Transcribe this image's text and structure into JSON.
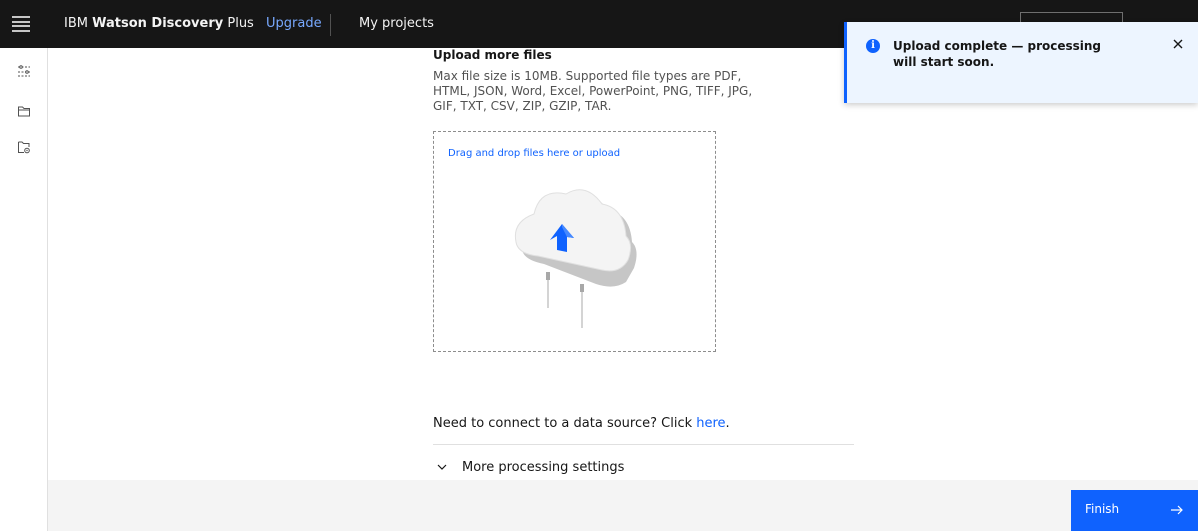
{
  "header": {
    "menu_icon": "hamburger-menu-icon",
    "brand_prefix": "IBM ",
    "brand_bold": "Watson Discovery",
    "brand_suffix": " Plus",
    "upgrade_label": "Upgrade",
    "my_projects_label": "My projects"
  },
  "side_rail": {
    "icons": [
      "settings-sliders-icon",
      "folder-icon",
      "folder-settings-icon"
    ]
  },
  "upload": {
    "title": "Upload more files",
    "description": "Max file size is 10MB. Supported file types are PDF, HTML, JSON, Word, Excel, PowerPoint, PNG, TIFF, JPG, GIF, TXT, CSV, ZIP, GZIP, TAR.",
    "dropzone_text": "Drag and drop files here or upload",
    "illustration": "cloud-upload-illustration"
  },
  "connect": {
    "prefix": "Need to connect to a data source? Click ",
    "link": "here",
    "suffix": "."
  },
  "accordion": {
    "label": "More processing settings",
    "icon": "chevron-down-icon"
  },
  "footer": {
    "finish_label": "Finish",
    "finish_icon": "arrow-right-icon"
  },
  "toast": {
    "icon": "info-icon",
    "message": "Upload complete — processing will start soon.",
    "close_icon": "close-icon"
  },
  "colors": {
    "header_bg": "#161616",
    "accent": "#0f62fe",
    "link_on_dark": "#78a9ff",
    "toast_bg": "#edf5ff",
    "footer_bg": "#f4f4f4"
  }
}
